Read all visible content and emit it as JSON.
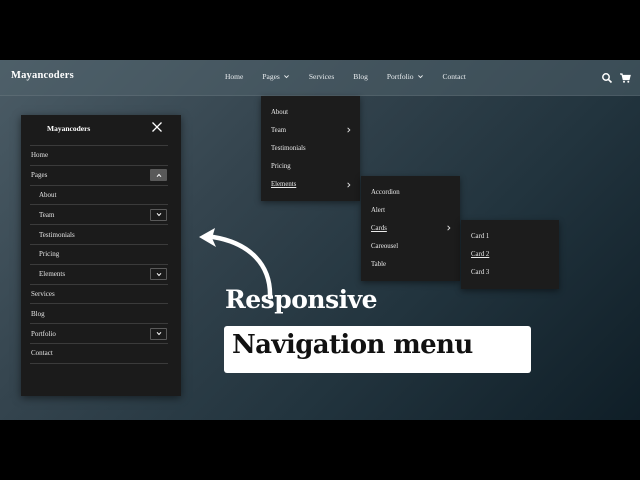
{
  "brand": "Mayancoders",
  "nav": {
    "links": [
      {
        "label": "Home"
      },
      {
        "label": "Pages"
      },
      {
        "label": "Services"
      },
      {
        "label": "Blog"
      },
      {
        "label": "Portfolio"
      },
      {
        "label": "Contact"
      }
    ],
    "icons": [
      "search-icon",
      "cart-icon"
    ]
  },
  "dropdown_pages": [
    "About",
    "Team",
    "Testimonials",
    "Pricing",
    "Elements"
  ],
  "dropdown_elements": [
    "Accordion",
    "Alert",
    "Cards",
    "Careousel",
    "Table"
  ],
  "dropdown_cards": [
    "Card 1",
    "Card 2",
    "Card 3"
  ],
  "mobile_menu": {
    "brand": "Mayancoders",
    "items": [
      "Home",
      "Pages",
      "About",
      "Team",
      "Testimonials",
      "Pricing",
      "Elements",
      "Services",
      "Blog",
      "Portfolio",
      "Contact"
    ]
  },
  "headline": {
    "line1": "Responsive",
    "line2": "Navigation menu"
  },
  "colors": {
    "panel": "#1c1c1c",
    "text": "#ffffff",
    "background_from": "#4b5c66",
    "background_to": "#0f1e27"
  }
}
